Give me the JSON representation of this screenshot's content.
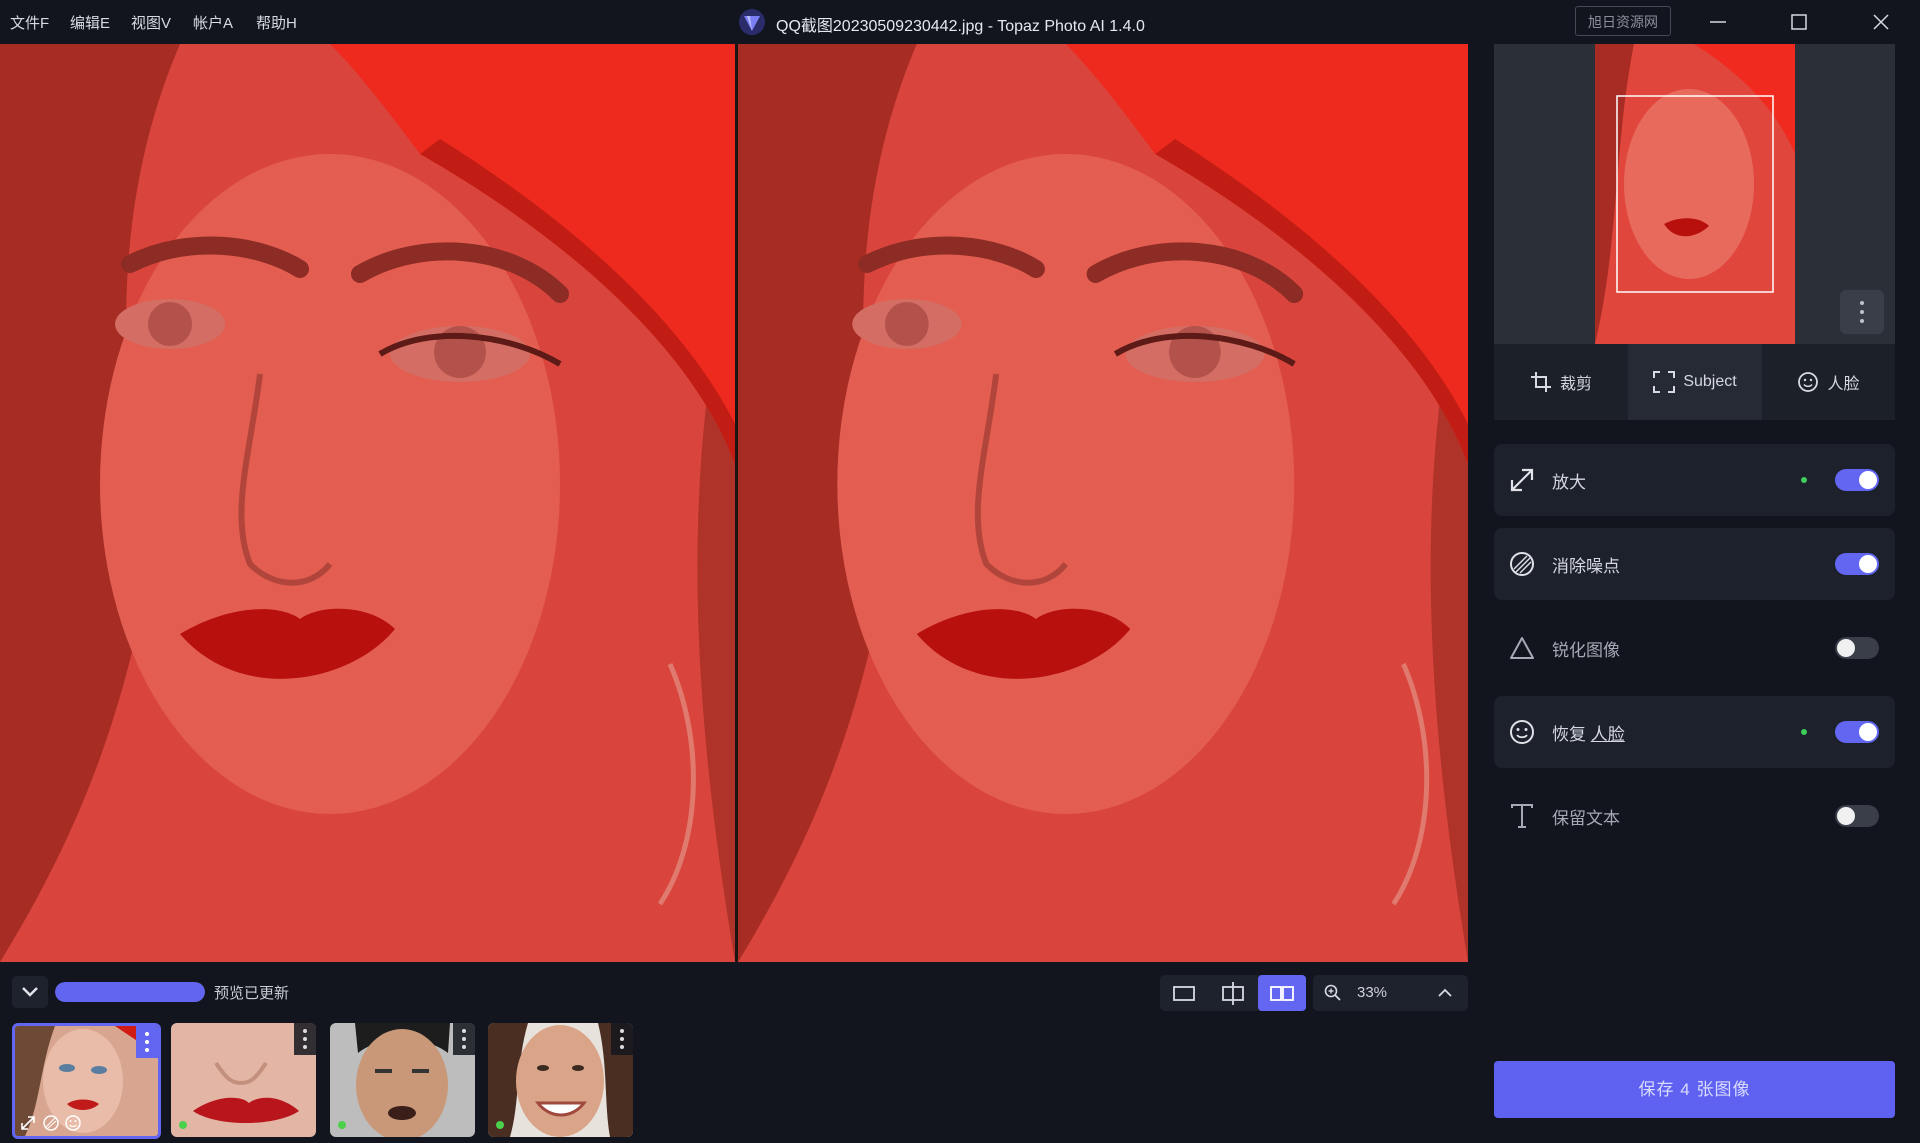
{
  "menu": [
    "文件F",
    "编辑E",
    "视图V",
    "帐户A",
    "帮助H"
  ],
  "window": {
    "title": "QQ截图20230509230442.jpg - Topaz Photo AI 1.4.0",
    "watermark": "旭日资源网",
    "controls": [
      "minimize-icon",
      "maximize-icon",
      "close-icon"
    ]
  },
  "colors": {
    "accent": "#6366f1",
    "status_green": "#3ccf5c",
    "image_red": "#e2463b"
  },
  "preview": {
    "status": "预览已更新",
    "progress_percent": 100,
    "zoom": "33%",
    "view_modes": [
      "single-view-icon",
      "split-view-icon",
      "side-by-side-icon"
    ],
    "active_view": "side-by-side-icon"
  },
  "thumbnails": [
    {
      "name": "thumbnail-woman-red-hat",
      "selected": true,
      "badges": [
        "upscale-icon",
        "denoise-icon",
        "face-icon"
      ]
    },
    {
      "name": "thumbnail-lips-closeup",
      "selected": false
    },
    {
      "name": "thumbnail-man-face",
      "selected": false
    },
    {
      "name": "thumbnail-smiling-woman",
      "selected": false
    }
  ],
  "tools": {
    "tabs": [
      "裁剪",
      "Subject",
      "人脸"
    ],
    "active_tab": "Subject"
  },
  "settings": [
    {
      "label": "放大",
      "icon": "upscale-icon",
      "enabled": true,
      "dot": true
    },
    {
      "label": "消除噪点",
      "icon": "denoise-icon",
      "enabled": true,
      "dot": false
    },
    {
      "label": "锐化图像",
      "icon": "sharpen-icon",
      "enabled": false,
      "dot": false
    },
    {
      "label_prefix": "恢复",
      "label_link": "人脸",
      "icon": "face-recovery-icon",
      "enabled": true,
      "dot": true
    },
    {
      "label": "保留文本",
      "icon": "text-icon",
      "enabled": false,
      "dot": false
    }
  ],
  "save_label": "保存 4 张图像"
}
